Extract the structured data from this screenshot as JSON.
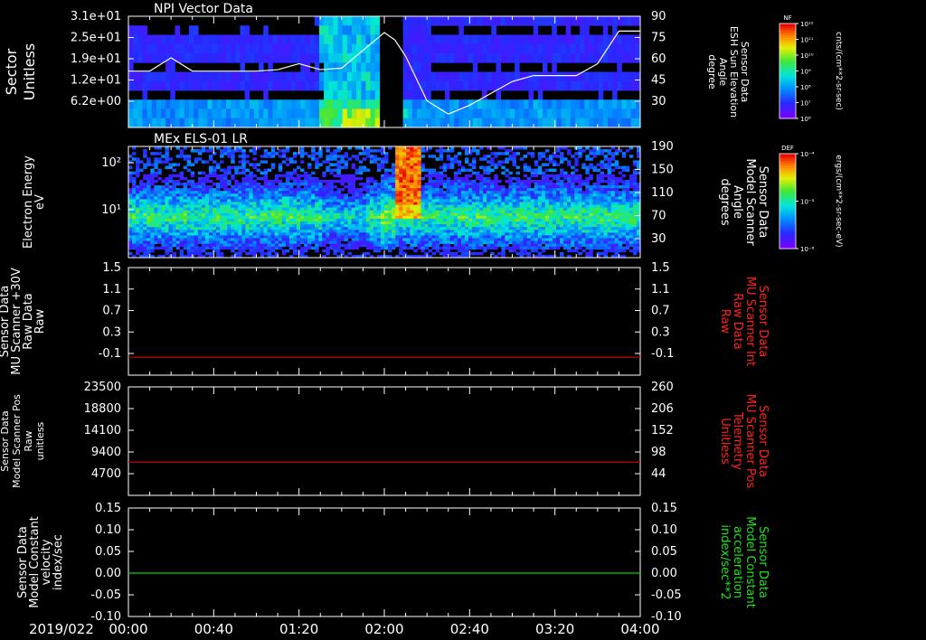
{
  "date_label": "2019/022",
  "time_ticks": [
    "00:00",
    "00:40",
    "01:20",
    "02:00",
    "02:40",
    "03:20",
    "04:00"
  ],
  "panels": [
    {
      "id": "npi",
      "title": "NPI Vector Data",
      "left_label_lines": [
        "Sector",
        "Unitless"
      ],
      "left_ticks": [
        "3.1e+01",
        "2.5e+01",
        "1.9e+01",
        "1.2e+01",
        "6.2e+00"
      ],
      "right_label_lines": [
        "Sensor Data",
        "ESH Sun Elevation",
        "Angle",
        "degree"
      ],
      "right_ticks": [
        "90",
        "75",
        "60",
        "45",
        "30"
      ],
      "colorbar": {
        "label": "NF",
        "unit": "cnts/(cm**2-sr-sec)",
        "ticks": [
          "10¹²",
          "10¹¹",
          "10¹⁰",
          "10⁹",
          "10⁸",
          "10⁷",
          "10⁶"
        ]
      }
    },
    {
      "id": "els",
      "title": "MEx ELS-01 LR",
      "left_label_lines": [
        "Electron Energy",
        "eV"
      ],
      "left_ticks": [
        "10²",
        "10¹"
      ],
      "right_label_lines": [
        "Sensor Data",
        "Model Scanner",
        "Angle",
        "degrees"
      ],
      "right_ticks": [
        "190",
        "150",
        "110",
        "70",
        "30"
      ],
      "colorbar": {
        "label": "DEF",
        "unit": "ergs/(cm**2-sr-sec-eV)",
        "ticks": [
          "10⁻⁴",
          "10⁻⁵",
          "10⁻⁶"
        ]
      }
    },
    {
      "id": "mu_int",
      "left_label_lines": [
        "Sensor Data",
        "MU Scanner +30V",
        "Raw Data",
        "Raw"
      ],
      "left_ticks": [
        "1.5",
        "1.1",
        "0.7",
        "0.3",
        "-0.1"
      ],
      "right_label_lines": [
        "Sensor Data",
        "MU Scanner Int",
        "Raw Data",
        "Raw"
      ],
      "right_ticks": [
        "1.5",
        "1.1",
        "0.7",
        "0.3",
        "-0.1"
      ]
    },
    {
      "id": "mu_pos",
      "left_label_lines": [
        "Sensor Data",
        "Model Scanner Pos",
        "Raw",
        "unitless"
      ],
      "left_ticks": [
        "23500",
        "18800",
        "14100",
        "9400",
        "4700"
      ],
      "right_label_lines": [
        "Sensor Data",
        "MU Scanner Pos",
        "Telemetry",
        "Unitless"
      ],
      "right_ticks": [
        "260",
        "206",
        "152",
        "98",
        "44"
      ]
    },
    {
      "id": "model",
      "left_label_lines": [
        "Sensor Data",
        "Model Constant",
        "velocity",
        "index/sec"
      ],
      "left_ticks": [
        "0.15",
        "0.10",
        "0.05",
        "0.00",
        "-0.05",
        "-0.10"
      ],
      "right_label_lines": [
        "Sensor Data",
        "Model Constant",
        "acceleration",
        "index/sec**2"
      ],
      "right_ticks": [
        "0.15",
        "0.10",
        "0.05",
        "0.00",
        "-0.05",
        "-0.10"
      ]
    }
  ],
  "chart_data": [
    {
      "type": "heatmap",
      "title": "NPI Vector Data",
      "x": [
        "00:00",
        "00:40",
        "01:20",
        "02:00",
        "02:40",
        "03:20",
        "04:00"
      ],
      "ylabel": "Sector Unitless",
      "y2label": "Sensor Data ESH Sun Elevation Angle degree",
      "overlay_series": {
        "name": "ESH Sun Elevation Angle",
        "color": "#ffffff",
        "x_min": [
          0,
          10,
          20,
          30,
          40,
          50,
          60,
          70,
          80,
          90,
          100,
          110,
          120,
          125,
          130,
          135,
          140,
          150,
          160,
          170,
          180,
          190,
          200,
          210,
          220,
          230,
          240
        ],
        "y": [
          53,
          53,
          62,
          53,
          53,
          53,
          53,
          54,
          58,
          54,
          55,
          67,
          79,
          74,
          63,
          48,
          33,
          24,
          30,
          38,
          46,
          50,
          50,
          50,
          58,
          80,
          80
        ]
      },
      "gap": [
        "01:58",
        "02:07"
      ]
    },
    {
      "type": "heatmap",
      "title": "MEx ELS-01 LR",
      "ylabel": "Electron Energy eV",
      "y2label": "Sensor Data Model Scanner Angle degrees",
      "ylog": true,
      "features": [
        "enhanced flux 02:05-02:18 at 20-150 eV"
      ]
    },
    {
      "type": "line",
      "ylabel": "Sensor Data MU Scanner +30V Raw Data Raw",
      "ylim": [
        -0.3,
        1.5
      ],
      "series": [
        {
          "color": "#d00000",
          "x": [
            "00:00",
            "04:00"
          ],
          "y": [
            0.0,
            0.0
          ]
        }
      ]
    },
    {
      "type": "line",
      "ylabel": "Sensor Data Model Scanner Pos Raw unitless",
      "ylim": [
        0,
        23500
      ],
      "series": [
        {
          "color": "#d00000",
          "x": [
            "00:00",
            "04:00"
          ],
          "y": [
            7200,
            7200
          ]
        }
      ]
    },
    {
      "type": "line",
      "ylabel": "Sensor Data Model Constant velocity index/sec",
      "ylim": [
        -0.1,
        0.15
      ],
      "series": [
        {
          "color": "#00d000",
          "x": [
            "00:00",
            "04:00"
          ],
          "y": [
            0.0,
            0.0
          ]
        }
      ]
    }
  ]
}
